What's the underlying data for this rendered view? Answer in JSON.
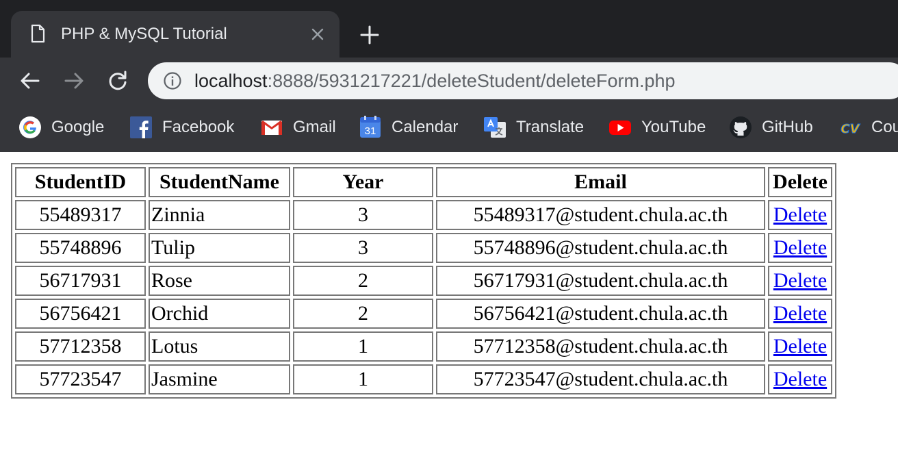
{
  "browser": {
    "tab": {
      "title": "PHP & MySQL Tutorial",
      "icon": "document-icon"
    },
    "address": {
      "host": "localhost",
      "rest": ":8888/5931217221/deleteStudent/deleteForm.php"
    },
    "bookmarks": [
      {
        "label": "Google",
        "icon": "google-icon"
      },
      {
        "label": "Facebook",
        "icon": "facebook-icon"
      },
      {
        "label": "Gmail",
        "icon": "gmail-icon"
      },
      {
        "label": "Calendar",
        "icon": "calendar-icon",
        "icon_text": "31"
      },
      {
        "label": "Translate",
        "icon": "translate-icon"
      },
      {
        "label": "YouTube",
        "icon": "youtube-icon"
      },
      {
        "label": "GitHub",
        "icon": "github-icon"
      },
      {
        "label": "Cou",
        "icon": "cv-icon",
        "icon_text": "CV"
      }
    ],
    "colors": {
      "frame": "#202124",
      "toolbar": "#35363a",
      "omnibox": "#f1f3f4",
      "link": "#0000ee"
    }
  },
  "table": {
    "headers": [
      "StudentID",
      "StudentName",
      "Year",
      "Email",
      "Delete"
    ],
    "rows": [
      {
        "id": "55489317",
        "name": "Zinnia",
        "year": "3",
        "email": "55489317@student.chula.ac.th",
        "action": "Delete"
      },
      {
        "id": "55748896",
        "name": "Tulip",
        "year": "3",
        "email": "55748896@student.chula.ac.th",
        "action": "Delete"
      },
      {
        "id": "56717931",
        "name": "Rose",
        "year": "2",
        "email": "56717931@student.chula.ac.th",
        "action": "Delete"
      },
      {
        "id": "56756421",
        "name": "Orchid",
        "year": "2",
        "email": "56756421@student.chula.ac.th",
        "action": "Delete"
      },
      {
        "id": "57712358",
        "name": "Lotus",
        "year": "1",
        "email": "57712358@student.chula.ac.th",
        "action": "Delete"
      },
      {
        "id": "57723547",
        "name": "Jasmine",
        "year": "1",
        "email": "57723547@student.chula.ac.th",
        "action": "Delete"
      }
    ]
  }
}
